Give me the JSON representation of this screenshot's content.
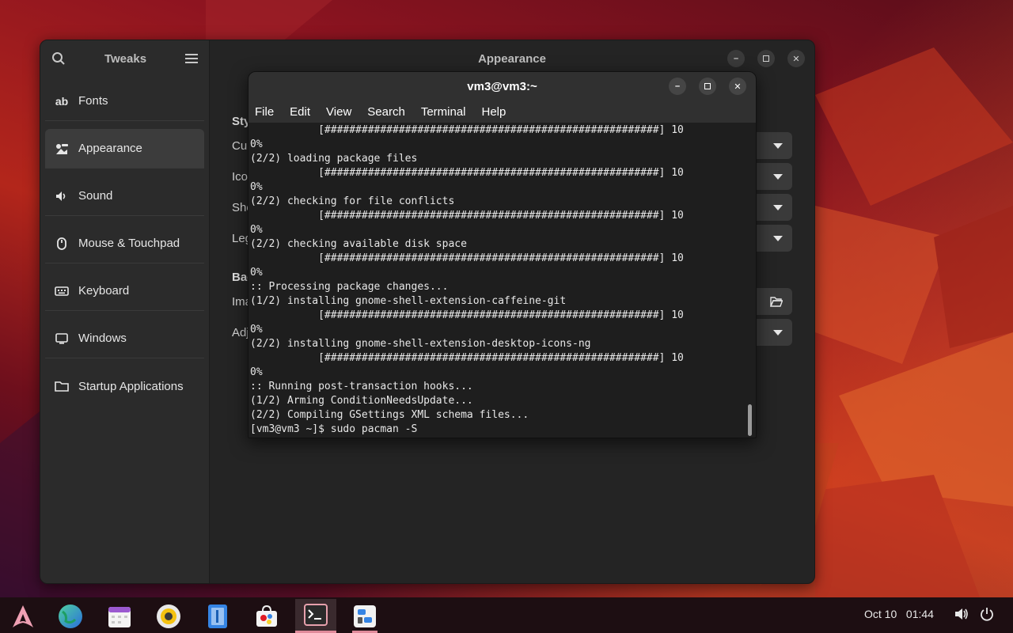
{
  "tweaks": {
    "sidebar_title": "Tweaks",
    "page_title": "Appearance",
    "items": [
      {
        "label": "Fonts",
        "icon": "font-icon"
      },
      {
        "label": "Appearance",
        "icon": "appearance-icon"
      },
      {
        "label": "Sound",
        "icon": "speaker-icon"
      },
      {
        "label": "Mouse & Touchpad",
        "icon": "mouse-icon"
      },
      {
        "label": "Keyboard",
        "icon": "keyboard-icon"
      },
      {
        "label": "Windows",
        "icon": "monitor-icon"
      },
      {
        "label": "Startup Applications",
        "icon": "folder-icon"
      }
    ],
    "sections": [
      "Sty",
      "Bac"
    ],
    "rows": [
      "Cur",
      "Ico",
      "She",
      "Leg",
      "Ima",
      "Adj"
    ]
  },
  "terminal": {
    "title": "vm3@vm3:~",
    "menu": [
      "File",
      "Edit",
      "View",
      "Search",
      "Terminal",
      "Help"
    ],
    "lines": [
      "           [######################################################] 10",
      "0%",
      "(2/2) loading package files",
      "           [######################################################] 10",
      "0%",
      "(2/2) checking for file conflicts",
      "           [######################################################] 10",
      "0%",
      "(2/2) checking available disk space",
      "           [######################################################] 10",
      "0%",
      ":: Processing package changes...",
      "(1/2) installing gnome-shell-extension-caffeine-git",
      "           [######################################################] 10",
      "0%",
      "(2/2) installing gnome-shell-extension-desktop-icons-ng",
      "           [######################################################] 10",
      "0%",
      ":: Running post-transaction hooks...",
      "(1/2) Arming ConditionNeedsUpdate...",
      "(2/2) Compiling GSettings XML schema files...",
      "[vm3@vm3 ~]$ sudo pacman -S"
    ]
  },
  "taskbar": {
    "date": "Oct 10",
    "time": "01:44",
    "apps": [
      "arch-launcher-icon",
      "browser-icon",
      "calendar-icon",
      "music-player-icon",
      "text-editor-icon",
      "software-store-icon",
      "terminal-icon",
      "tweaks-icon"
    ]
  }
}
